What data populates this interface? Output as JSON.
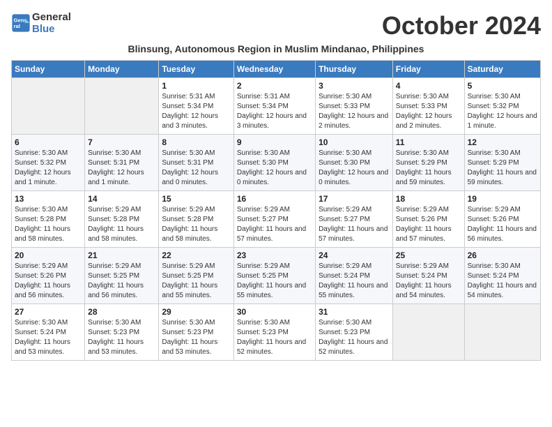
{
  "header": {
    "logo_line1": "General",
    "logo_line2": "Blue",
    "month_title": "October 2024",
    "subtitle": "Blinsung, Autonomous Region in Muslim Mindanao, Philippines"
  },
  "days_of_week": [
    "Sunday",
    "Monday",
    "Tuesday",
    "Wednesday",
    "Thursday",
    "Friday",
    "Saturday"
  ],
  "weeks": [
    [
      {
        "day": "",
        "sunrise": "",
        "sunset": "",
        "daylight": ""
      },
      {
        "day": "",
        "sunrise": "",
        "sunset": "",
        "daylight": ""
      },
      {
        "day": "1",
        "sunrise": "Sunrise: 5:31 AM",
        "sunset": "Sunset: 5:34 PM",
        "daylight": "Daylight: 12 hours and 3 minutes."
      },
      {
        "day": "2",
        "sunrise": "Sunrise: 5:31 AM",
        "sunset": "Sunset: 5:34 PM",
        "daylight": "Daylight: 12 hours and 3 minutes."
      },
      {
        "day": "3",
        "sunrise": "Sunrise: 5:30 AM",
        "sunset": "Sunset: 5:33 PM",
        "daylight": "Daylight: 12 hours and 2 minutes."
      },
      {
        "day": "4",
        "sunrise": "Sunrise: 5:30 AM",
        "sunset": "Sunset: 5:33 PM",
        "daylight": "Daylight: 12 hours and 2 minutes."
      },
      {
        "day": "5",
        "sunrise": "Sunrise: 5:30 AM",
        "sunset": "Sunset: 5:32 PM",
        "daylight": "Daylight: 12 hours and 1 minute."
      }
    ],
    [
      {
        "day": "6",
        "sunrise": "Sunrise: 5:30 AM",
        "sunset": "Sunset: 5:32 PM",
        "daylight": "Daylight: 12 hours and 1 minute."
      },
      {
        "day": "7",
        "sunrise": "Sunrise: 5:30 AM",
        "sunset": "Sunset: 5:31 PM",
        "daylight": "Daylight: 12 hours and 1 minute."
      },
      {
        "day": "8",
        "sunrise": "Sunrise: 5:30 AM",
        "sunset": "Sunset: 5:31 PM",
        "daylight": "Daylight: 12 hours and 0 minutes."
      },
      {
        "day": "9",
        "sunrise": "Sunrise: 5:30 AM",
        "sunset": "Sunset: 5:30 PM",
        "daylight": "Daylight: 12 hours and 0 minutes."
      },
      {
        "day": "10",
        "sunrise": "Sunrise: 5:30 AM",
        "sunset": "Sunset: 5:30 PM",
        "daylight": "Daylight: 12 hours and 0 minutes."
      },
      {
        "day": "11",
        "sunrise": "Sunrise: 5:30 AM",
        "sunset": "Sunset: 5:29 PM",
        "daylight": "Daylight: 11 hours and 59 minutes."
      },
      {
        "day": "12",
        "sunrise": "Sunrise: 5:30 AM",
        "sunset": "Sunset: 5:29 PM",
        "daylight": "Daylight: 11 hours and 59 minutes."
      }
    ],
    [
      {
        "day": "13",
        "sunrise": "Sunrise: 5:30 AM",
        "sunset": "Sunset: 5:28 PM",
        "daylight": "Daylight: 11 hours and 58 minutes."
      },
      {
        "day": "14",
        "sunrise": "Sunrise: 5:29 AM",
        "sunset": "Sunset: 5:28 PM",
        "daylight": "Daylight: 11 hours and 58 minutes."
      },
      {
        "day": "15",
        "sunrise": "Sunrise: 5:29 AM",
        "sunset": "Sunset: 5:28 PM",
        "daylight": "Daylight: 11 hours and 58 minutes."
      },
      {
        "day": "16",
        "sunrise": "Sunrise: 5:29 AM",
        "sunset": "Sunset: 5:27 PM",
        "daylight": "Daylight: 11 hours and 57 minutes."
      },
      {
        "day": "17",
        "sunrise": "Sunrise: 5:29 AM",
        "sunset": "Sunset: 5:27 PM",
        "daylight": "Daylight: 11 hours and 57 minutes."
      },
      {
        "day": "18",
        "sunrise": "Sunrise: 5:29 AM",
        "sunset": "Sunset: 5:26 PM",
        "daylight": "Daylight: 11 hours and 57 minutes."
      },
      {
        "day": "19",
        "sunrise": "Sunrise: 5:29 AM",
        "sunset": "Sunset: 5:26 PM",
        "daylight": "Daylight: 11 hours and 56 minutes."
      }
    ],
    [
      {
        "day": "20",
        "sunrise": "Sunrise: 5:29 AM",
        "sunset": "Sunset: 5:26 PM",
        "daylight": "Daylight: 11 hours and 56 minutes."
      },
      {
        "day": "21",
        "sunrise": "Sunrise: 5:29 AM",
        "sunset": "Sunset: 5:25 PM",
        "daylight": "Daylight: 11 hours and 56 minutes."
      },
      {
        "day": "22",
        "sunrise": "Sunrise: 5:29 AM",
        "sunset": "Sunset: 5:25 PM",
        "daylight": "Daylight: 11 hours and 55 minutes."
      },
      {
        "day": "23",
        "sunrise": "Sunrise: 5:29 AM",
        "sunset": "Sunset: 5:25 PM",
        "daylight": "Daylight: 11 hours and 55 minutes."
      },
      {
        "day": "24",
        "sunrise": "Sunrise: 5:29 AM",
        "sunset": "Sunset: 5:24 PM",
        "daylight": "Daylight: 11 hours and 55 minutes."
      },
      {
        "day": "25",
        "sunrise": "Sunrise: 5:29 AM",
        "sunset": "Sunset: 5:24 PM",
        "daylight": "Daylight: 11 hours and 54 minutes."
      },
      {
        "day": "26",
        "sunrise": "Sunrise: 5:30 AM",
        "sunset": "Sunset: 5:24 PM",
        "daylight": "Daylight: 11 hours and 54 minutes."
      }
    ],
    [
      {
        "day": "27",
        "sunrise": "Sunrise: 5:30 AM",
        "sunset": "Sunset: 5:24 PM",
        "daylight": "Daylight: 11 hours and 53 minutes."
      },
      {
        "day": "28",
        "sunrise": "Sunrise: 5:30 AM",
        "sunset": "Sunset: 5:23 PM",
        "daylight": "Daylight: 11 hours and 53 minutes."
      },
      {
        "day": "29",
        "sunrise": "Sunrise: 5:30 AM",
        "sunset": "Sunset: 5:23 PM",
        "daylight": "Daylight: 11 hours and 53 minutes."
      },
      {
        "day": "30",
        "sunrise": "Sunrise: 5:30 AM",
        "sunset": "Sunset: 5:23 PM",
        "daylight": "Daylight: 11 hours and 52 minutes."
      },
      {
        "day": "31",
        "sunrise": "Sunrise: 5:30 AM",
        "sunset": "Sunset: 5:23 PM",
        "daylight": "Daylight: 11 hours and 52 minutes."
      },
      {
        "day": "",
        "sunrise": "",
        "sunset": "",
        "daylight": ""
      },
      {
        "day": "",
        "sunrise": "",
        "sunset": "",
        "daylight": ""
      }
    ]
  ]
}
